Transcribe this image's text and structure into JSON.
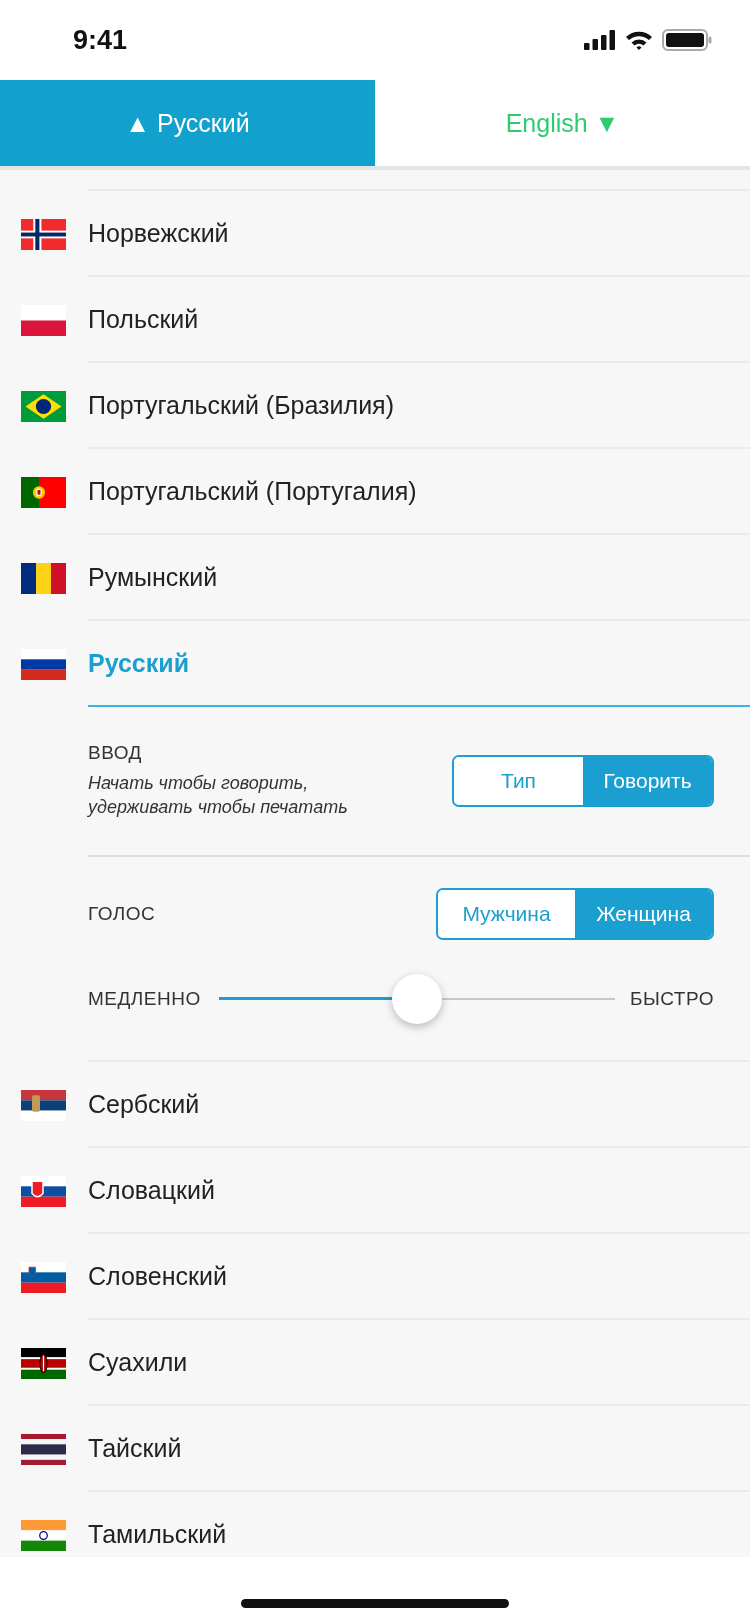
{
  "status_bar": {
    "time": "9:41"
  },
  "language_tabs": [
    {
      "label": "▲ Русский",
      "selected": true
    },
    {
      "label": "English ▼",
      "selected": false
    }
  ],
  "languages": [
    {
      "name": "Норвежский",
      "selected": false
    },
    {
      "name": "Польский",
      "selected": false
    },
    {
      "name": "Португальский (Бразилия)",
      "selected": false
    },
    {
      "name": "Португальский (Португалия)",
      "selected": false
    },
    {
      "name": "Румынский",
      "selected": false
    },
    {
      "name": "Русский",
      "selected": true,
      "settings": {
        "input": {
          "label": "ВВОД",
          "hint": "Начать чтобы говорить,\nудерживать чтобы печатать",
          "options": [
            {
              "label": "Тип",
              "selected": false
            },
            {
              "label": "Говорить",
              "selected": true
            }
          ]
        },
        "voice": {
          "label": "ГОЛОС",
          "options": [
            {
              "label": "Мужчина",
              "selected": false
            },
            {
              "label": "Женщина",
              "selected": true
            }
          ]
        },
        "speed": {
          "min_label": "МЕДЛЕННО",
          "max_label": "БЫСТРО",
          "level": 0.5
        }
      }
    },
    {
      "name": "Сербский",
      "selected": false
    },
    {
      "name": "Словацкий",
      "selected": false
    },
    {
      "name": "Словенский",
      "selected": false
    },
    {
      "name": "Суахили",
      "selected": false
    },
    {
      "name": "Тайский",
      "selected": false
    },
    {
      "name": "Тамильский",
      "selected": false
    }
  ]
}
